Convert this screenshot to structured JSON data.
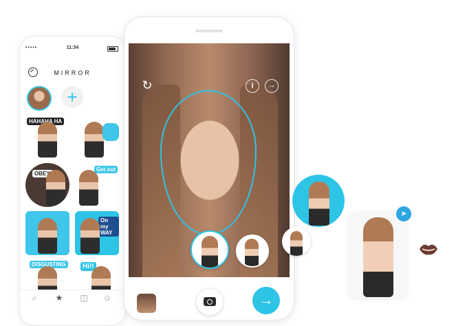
{
  "left_phone": {
    "status": {
      "time": "11:34",
      "signal": "•••••"
    },
    "app_title": "MIRROR",
    "add_label": "+",
    "stickers": [
      {
        "caption": "HAHAHA HA"
      },
      {
        "caption": ""
      },
      {
        "caption": "OBEY!"
      },
      {
        "caption": "Get out"
      },
      {
        "caption": ""
      },
      {
        "caption": "On my WAY"
      },
      {
        "caption": "DISGUSTING"
      },
      {
        "caption": "Hi!!"
      }
    ],
    "tabs": [
      "search-icon",
      "star-icon",
      "camera-icon",
      "emoji-icon"
    ]
  },
  "center_phone": {
    "info_label": "i",
    "share_label": "→",
    "next_label": "→",
    "switch_camera_label": "↻"
  },
  "right_panel": {
    "telegram_label": "➤"
  },
  "colors": {
    "accent": "#2ec4e6",
    "telegram": "#2ea6e2"
  }
}
